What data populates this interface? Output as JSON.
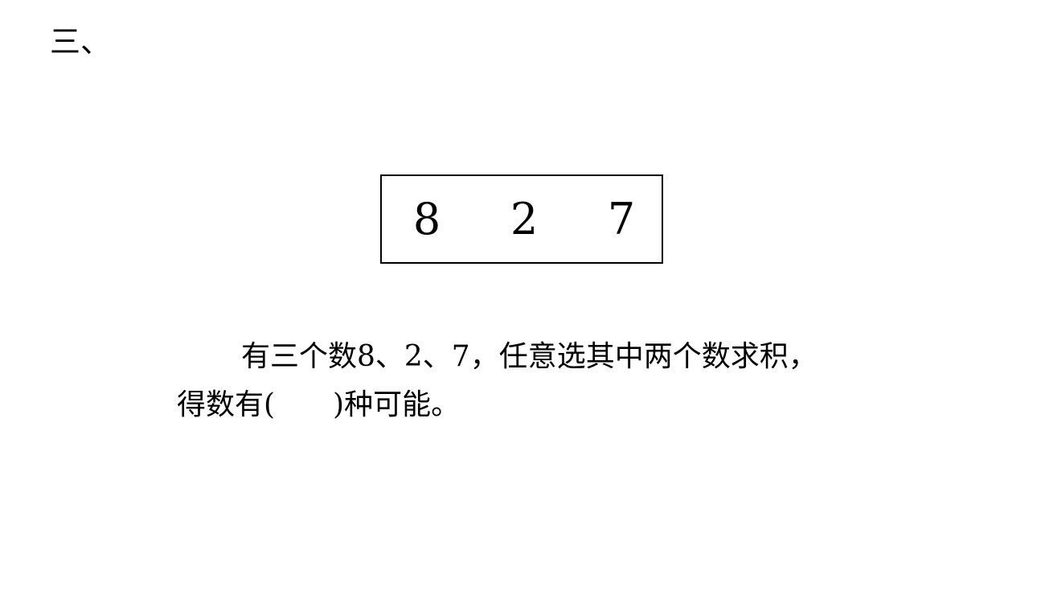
{
  "section": {
    "number": "三、"
  },
  "number_box": {
    "digits": [
      "8",
      "2",
      "7"
    ]
  },
  "question": {
    "line1": "有三个数8、2、7，任意选其中两个数求积，",
    "line2_prefix": "得数有(",
    "line2_suffix": ")种可能。"
  }
}
